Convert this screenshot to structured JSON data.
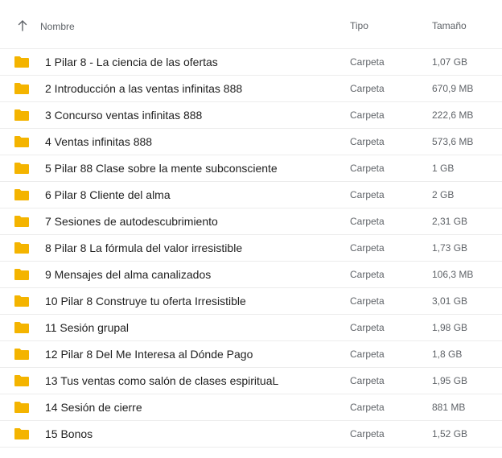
{
  "header": {
    "name_label": "Nombre",
    "type_label": "Tipo",
    "size_label": "Tamaño",
    "sort_icon": "arrow-up-icon"
  },
  "colors": {
    "folder": "#f4b400",
    "text": "#1f1f1f",
    "muted": "#5f6368",
    "divider": "#ececec"
  },
  "files": [
    {
      "name": "1 Pilar 8 - La ciencia de las ofertas",
      "type": "Carpeta",
      "size": "1,07 GB",
      "icon": "folder-icon"
    },
    {
      "name": "2 Introducción a las ventas infinitas 888",
      "type": "Carpeta",
      "size": "670,9 MB",
      "icon": "folder-icon"
    },
    {
      "name": "3 Concurso ventas infinitas 888",
      "type": "Carpeta",
      "size": "222,6 MB",
      "icon": "folder-icon"
    },
    {
      "name": "4 Ventas infinitas 888",
      "type": "Carpeta",
      "size": "573,6 MB",
      "icon": "folder-icon"
    },
    {
      "name": "5 Pilar 88 Clase sobre la mente subconsciente",
      "type": "Carpeta",
      "size": "1 GB",
      "icon": "folder-icon"
    },
    {
      "name": "6 Pilar 8 Cliente del alma",
      "type": "Carpeta",
      "size": "2 GB",
      "icon": "folder-icon"
    },
    {
      "name": "7 Sesiones de autodescubrimiento",
      "type": "Carpeta",
      "size": "2,31 GB",
      "icon": "folder-icon"
    },
    {
      "name": "8 Pilar 8 La fórmula del valor irresistible",
      "type": "Carpeta",
      "size": "1,73 GB",
      "icon": "folder-icon"
    },
    {
      "name": "9 Mensajes del alma canalizados",
      "type": "Carpeta",
      "size": "106,3 MB",
      "icon": "folder-icon"
    },
    {
      "name": "10 Pilar 8 Construye tu oferta Irresistible",
      "type": "Carpeta",
      "size": "3,01 GB",
      "icon": "folder-icon"
    },
    {
      "name": "11 Sesión grupal",
      "type": "Carpeta",
      "size": "1,98 GB",
      "icon": "folder-icon"
    },
    {
      "name": "12 Pilar 8 Del Me Interesa al Dónde Pago",
      "type": "Carpeta",
      "size": "1,8 GB",
      "icon": "folder-icon"
    },
    {
      "name": "13 Tus ventas como salón de clases espirituaL",
      "type": "Carpeta",
      "size": "1,95 GB",
      "icon": "folder-icon"
    },
    {
      "name": "14 Sesión de cierre",
      "type": "Carpeta",
      "size": "881 MB",
      "icon": "folder-icon"
    },
    {
      "name": "15 Bonos",
      "type": "Carpeta",
      "size": "1,52 GB",
      "icon": "folder-icon"
    }
  ]
}
